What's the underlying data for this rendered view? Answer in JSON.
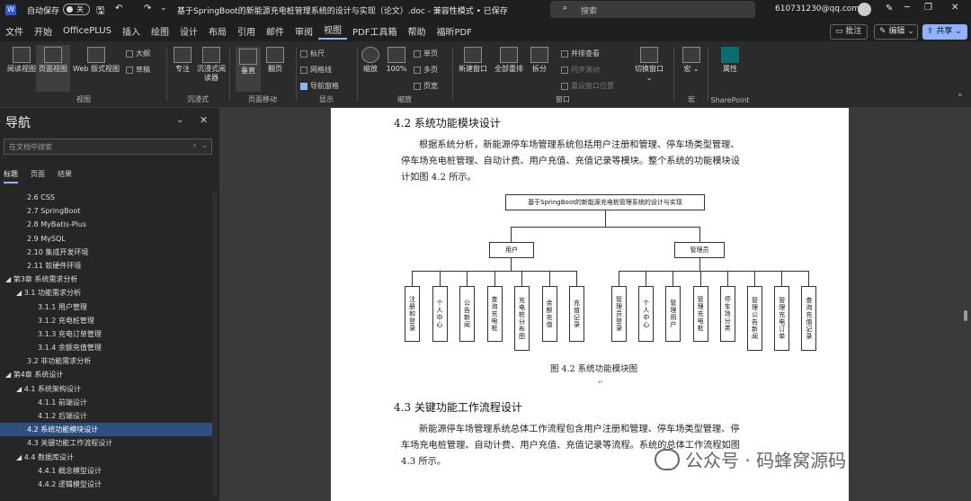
{
  "titlebar": {
    "autosave": "自动保存",
    "autosave_state": "关",
    "doc_title": "基于SpringBoot的新能源充电桩管理系统的设计与实现（论文）.doc - 兼容性模式 • 已保存",
    "search_placeholder": "搜索",
    "account": "610731230@qq.com"
  },
  "menu": [
    "文件",
    "开始",
    "OfficePLUS",
    "插入",
    "绘图",
    "设计",
    "布局",
    "引用",
    "邮件",
    "审阅",
    "视图",
    "PDF工具箱",
    "帮助",
    "福昕PDF"
  ],
  "menu_active": "视图",
  "menu_right": {
    "comment": "批注",
    "edit": "编辑",
    "share": "共享"
  },
  "ribbon": {
    "views": {
      "read": "阅读视图",
      "print": "页面视图",
      "web": "Web 版式视图",
      "outline": "大纲",
      "draft": "草稿",
      "label": "视图"
    },
    "immersive": {
      "focus": "专注",
      "reader": "沉浸式阅读器",
      "label": "沉浸式"
    },
    "pagemove": {
      "vertical": "垂直",
      "side": "翻页",
      "label": "页面移动"
    },
    "show": {
      "ruler": "标尺",
      "grid": "网格线",
      "navpane": "导航窗格",
      "label": "显示"
    },
    "zoom": {
      "zoom": "缩放",
      "p100": "100%",
      "one": "单页",
      "multi": "多页",
      "width": "页宽",
      "label": "缩放"
    },
    "window": {
      "new": "新建窗口",
      "arrange": "全部重排",
      "split": "拆分",
      "side": "并排查看",
      "sync": "同步滚动",
      "reset": "重设窗口位置",
      "switch": "切换窗口",
      "label": "窗口"
    },
    "macro": {
      "macros": "宏",
      "label": "宏"
    },
    "sharepoint": {
      "props": "属性",
      "label": "SharePoint"
    }
  },
  "nav": {
    "title": "导航",
    "search_placeholder": "在文档中搜索",
    "tabs": [
      "标题",
      "页面",
      "结果"
    ],
    "items": [
      {
        "t": "2.6 CSS",
        "lvl": 2
      },
      {
        "t": "2.7 SpringBoot",
        "lvl": 2
      },
      {
        "t": "2.8 MyBatis-Plus",
        "lvl": 2
      },
      {
        "t": "2.9 MySQL",
        "lvl": 2
      },
      {
        "t": "2.10 集成开发环境",
        "lvl": 2
      },
      {
        "t": "2.11 软硬件环境",
        "lvl": 2
      },
      {
        "t": "◢ 第3章 系统需求分析",
        "lvl": 0
      },
      {
        "t": "◢ 3.1 功能需求分析",
        "lvl": 1
      },
      {
        "t": "3.1.1 用户管理",
        "lvl": 3
      },
      {
        "t": "3.1.2 充电桩管理",
        "lvl": 3
      },
      {
        "t": "3.1.3 充电订单管理",
        "lvl": 3
      },
      {
        "t": "3.1.4 余额充值管理",
        "lvl": 3
      },
      {
        "t": "3.2 非功能需求分析",
        "lvl": 2
      },
      {
        "t": "◢ 第4章 系统设计",
        "lvl": 0
      },
      {
        "t": "◢ 4.1 系统架构设计",
        "lvl": 1
      },
      {
        "t": "4.1.1 前端设计",
        "lvl": 3
      },
      {
        "t": "4.1.2 后端设计",
        "lvl": 3
      },
      {
        "t": "4.2 系统功能模块设计",
        "lvl": 2,
        "sel": true
      },
      {
        "t": "4.3 关键功能工作流程设计",
        "lvl": 2
      },
      {
        "t": "◢ 4.4 数据库设计",
        "lvl": 1
      },
      {
        "t": "4.4.1 概念模型设计",
        "lvl": 3
      },
      {
        "t": "4.4.2 逻辑模型设计",
        "lvl": 3
      }
    ]
  },
  "doc": {
    "h1": "4.2   系统功能模块设计",
    "p1": [
      "根据系统分析，新能源停车场管理系统包括用户注册和管理、停车场类型管理、",
      "停车场充电桩管理、自动计费、用户充值、充值记录等模块。整个系统的功能模块设",
      "计如图 4.2 所示。"
    ],
    "diagram": {
      "root": "基于SpringBoot的新能源充电桩管理系统的设计与实现",
      "user": "用户",
      "admin": "管理员",
      "user_items": [
        "注册和登录",
        "个人中心",
        "公告新闻",
        "查询充电桩",
        "充电桩分布图",
        "余额充值",
        "充值记录"
      ],
      "admin_items": [
        "管理员登录",
        "个人中心",
        "管理用户",
        "管理充电桩",
        "停车场分类",
        "管理公告新闻",
        "管理充电订单",
        "查询充值记录"
      ]
    },
    "caption": "图 4.2  系统功能模块图",
    "h2": "4.3   关键功能工作流程设计",
    "p2": [
      "新能源停车场管理系统总体工作流程包含用户注册和管理、停车场类型管理、停",
      "车场充电桩管理、自动计费、用户充值、充值记录等流程。系统的总体工作流程如图",
      "4.3 所示。"
    ]
  },
  "watermark": "公众号 · 码蜂窝源码"
}
